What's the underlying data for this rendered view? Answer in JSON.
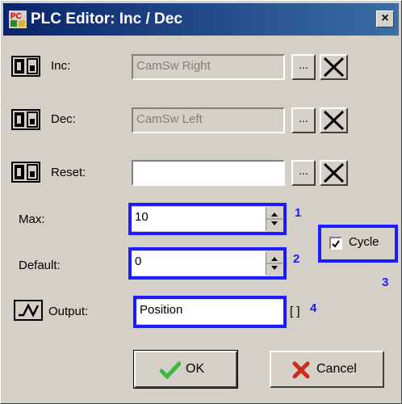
{
  "window": {
    "title": "PLC Editor: Inc / Dec",
    "close_label": "×"
  },
  "rows": [
    {
      "label": "Inc:",
      "value": "CamSw Right"
    },
    {
      "label": "Dec:",
      "value": "CamSw Left"
    },
    {
      "label": "Reset:",
      "value": ""
    }
  ],
  "browse_label": "...",
  "max": {
    "label": "Max:",
    "value": "10",
    "callout": "1"
  },
  "default": {
    "label": "Default:",
    "value": "0",
    "callout": "2"
  },
  "cycle": {
    "label": "Cycle",
    "checked": true,
    "callout": "3"
  },
  "output": {
    "label": "Output:",
    "value": "Position",
    "suffix": "[ ]",
    "callout": "4"
  },
  "buttons": {
    "ok": "OK",
    "cancel": "Cancel"
  },
  "colors": {
    "titlebar": "#0a246a",
    "highlight": "#1c1cff",
    "ok_check": "#3cb83c",
    "cancel_x": "#cc2a1a"
  }
}
